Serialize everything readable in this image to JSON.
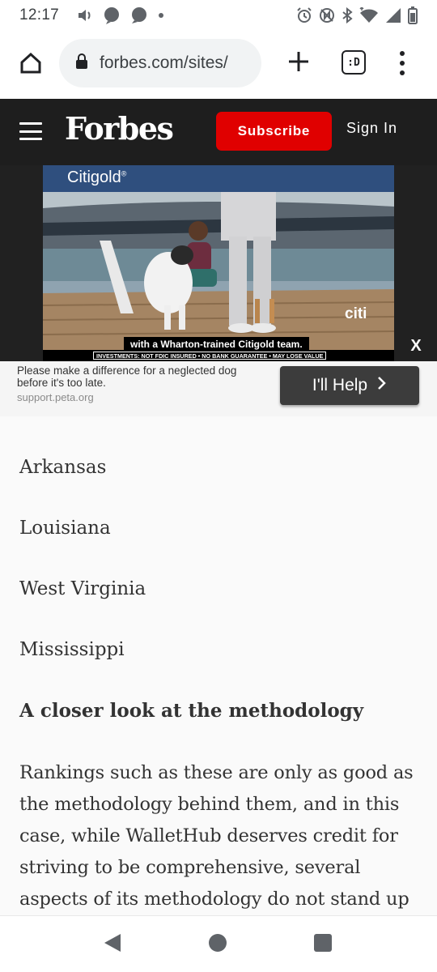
{
  "status_bar": {
    "time": "12:17",
    "left_icons": [
      "volume-icon",
      "messenger-icon",
      "chat-icon",
      "dot-icon"
    ],
    "right_icons": [
      "alarm-icon",
      "nfc-icon",
      "bluetooth-icon",
      "wifi-icon",
      "signal-icon",
      "battery-icon"
    ]
  },
  "browser": {
    "url": "forbes.com/sites/",
    "tabs_label": ":D"
  },
  "forbes_header": {
    "logo": "Forbes",
    "subscribe_label": "Subscribe",
    "signin_label": "Sign In"
  },
  "ad": {
    "brand": "Citigold",
    "brand_mark": "®",
    "citi_logo": "citi",
    "caption": "with a Wharton-trained Citigold team.",
    "disclaimer": "INVESTMENTS: NOT FDIC INSURED • NO BANK GUARANTEE • MAY LOSE VALUE",
    "close_label": "X",
    "promo_text": "Please make a difference for a neglected dog before it's too late.",
    "promo_url": "support.peta.org",
    "cta_label": "I'll Help"
  },
  "article": {
    "states": [
      "Arkansas",
      "Louisiana",
      "West Virginia",
      "Mississippi"
    ],
    "heading": "A closer look at the methodology",
    "paragraph": "Rankings such as these are only as good as the methodology behind them, and in this case, while WalletHub deserves credit for striving to be comprehensive, several aspects of its methodology do not stand up"
  },
  "colors": {
    "forbes_header_bg": "#1e1e1e",
    "subscribe_red": "#e00000",
    "ad_band_blue": "#2f4f7e",
    "cta_bg": "#3c3c3c"
  }
}
